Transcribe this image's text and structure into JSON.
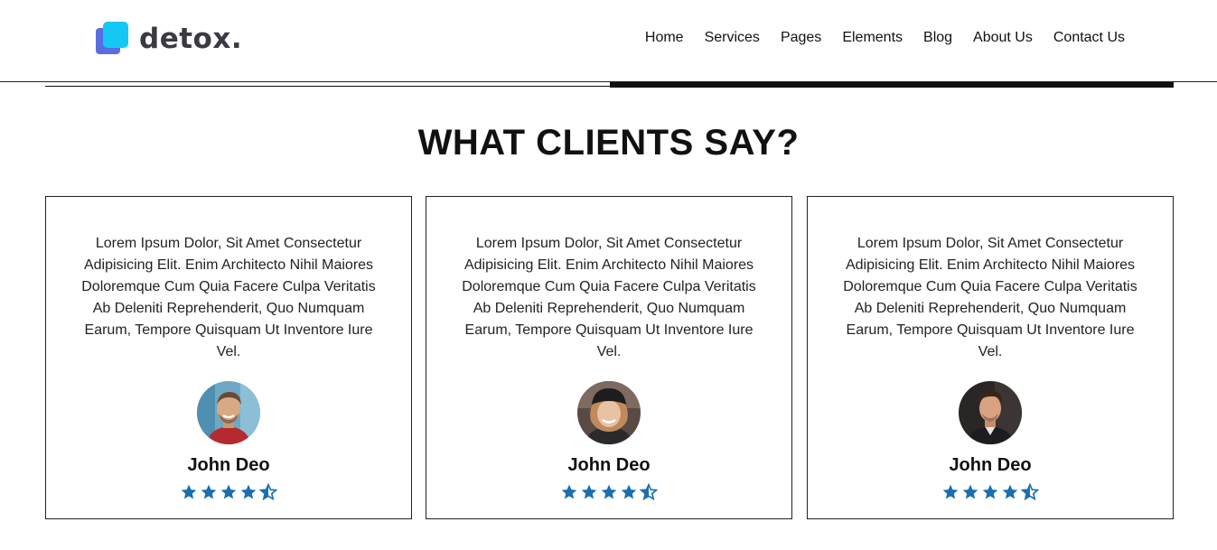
{
  "brand": {
    "name": "detox."
  },
  "nav": {
    "items": [
      "Home",
      "Services",
      "Pages",
      "Elements",
      "Blog",
      "About Us",
      "Contact Us"
    ]
  },
  "section": {
    "title": "WHAT CLIENTS SAY?"
  },
  "testimonials": [
    {
      "text": "Lorem Ipsum Dolor, Sit Amet Consectetur Adipisicing Elit. Enim Architecto Nihil Maiores Doloremque Cum Quia Facere Culpa Veritatis Ab Deleniti Reprehenderit, Quo Numquam Earum, Tempore Quisquam Ut Inventore Iure Vel.",
      "name": "John Deo",
      "rating": 4.5,
      "avatar_icon": "smiling-man-avatar"
    },
    {
      "text": "Lorem Ipsum Dolor, Sit Amet Consectetur Adipisicing Elit. Enim Architecto Nihil Maiores Doloremque Cum Quia Facere Culpa Veritatis Ab Deleniti Reprehenderit, Quo Numquam Earum, Tempore Quisquam Ut Inventore Iure Vel.",
      "name": "John Deo",
      "rating": 4.5,
      "avatar_icon": "smiling-woman-avatar"
    },
    {
      "text": "Lorem Ipsum Dolor, Sit Amet Consectetur Adipisicing Elit. Enim Architecto Nihil Maiores Doloremque Cum Quia Facere Culpa Veritatis Ab Deleniti Reprehenderit, Quo Numquam Earum, Tempore Quisquam Ut Inventore Iure Vel.",
      "name": "John Deo",
      "rating": 4.5,
      "avatar_icon": "serious-man-avatar"
    }
  ],
  "colors": {
    "star": "#1a6fb0",
    "logo_front": "#14c8f5",
    "logo_back": "#5a6de0"
  }
}
